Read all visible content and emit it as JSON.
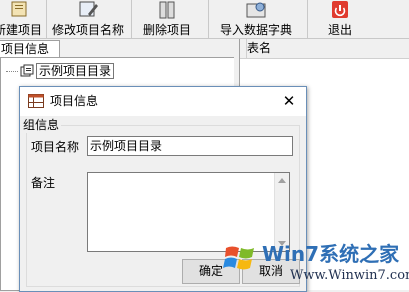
{
  "toolbar": {
    "buttons": [
      {
        "label": "新建项目",
        "icon": "new-project-icon"
      },
      {
        "label": "修改项目名称",
        "icon": "edit-project-icon"
      },
      {
        "label": "删除项目",
        "icon": "delete-project-icon"
      },
      {
        "label": "导入数据字典",
        "icon": "import-dictionary-icon"
      },
      {
        "label": "退出",
        "icon": "exit-icon"
      }
    ]
  },
  "left_panel": {
    "tab": "项目信息",
    "tree_item": "示例项目目录"
  },
  "right_panel": {
    "column": "表名"
  },
  "dialog": {
    "title": "项目信息",
    "group": "组信息",
    "name_label": "项目名称",
    "name_value": "示例项目目录",
    "note_label": "备注",
    "note_value": "",
    "ok": "确定",
    "cancel": "取消"
  },
  "watermark": {
    "title": "Win7系统之家",
    "url": "Www.Winwin7.com"
  },
  "colors": {
    "exit_red": "#e03a2e",
    "dialog_border": "#6a8fb8"
  }
}
